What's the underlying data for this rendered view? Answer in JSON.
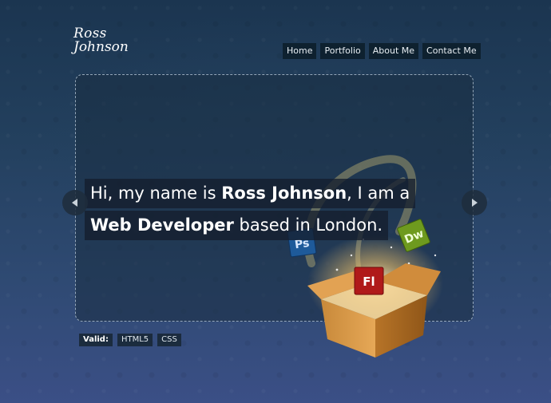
{
  "logo": {
    "line1": "Ross",
    "line2": "Johnson"
  },
  "nav": [
    {
      "label": "Home"
    },
    {
      "label": "Portfolio"
    },
    {
      "label": "About Me"
    },
    {
      "label": "Contact Me"
    }
  ],
  "hero": {
    "line1_pre": "Hi, my name is ",
    "line1_bold": "Ross Johnson",
    "line1_post": ", I am a",
    "line2_bold": "Web Developer",
    "line2_post": " based in London."
  },
  "badges": {
    "ps": "Ps",
    "dw": "Dw",
    "fl": "Fl"
  },
  "icons": {
    "prev": "arrow-left-icon",
    "next": "arrow-right-icon"
  },
  "footer": {
    "valid_label": "Valid:",
    "links": [
      {
        "label": "HTML5"
      },
      {
        "label": "CSS"
      }
    ]
  },
  "colors": {
    "accent_gold": "#e0a84a",
    "flash_red": "#b01a1a",
    "ps_blue": "#1e5a9a",
    "dw_green": "#6e9a1e"
  }
}
